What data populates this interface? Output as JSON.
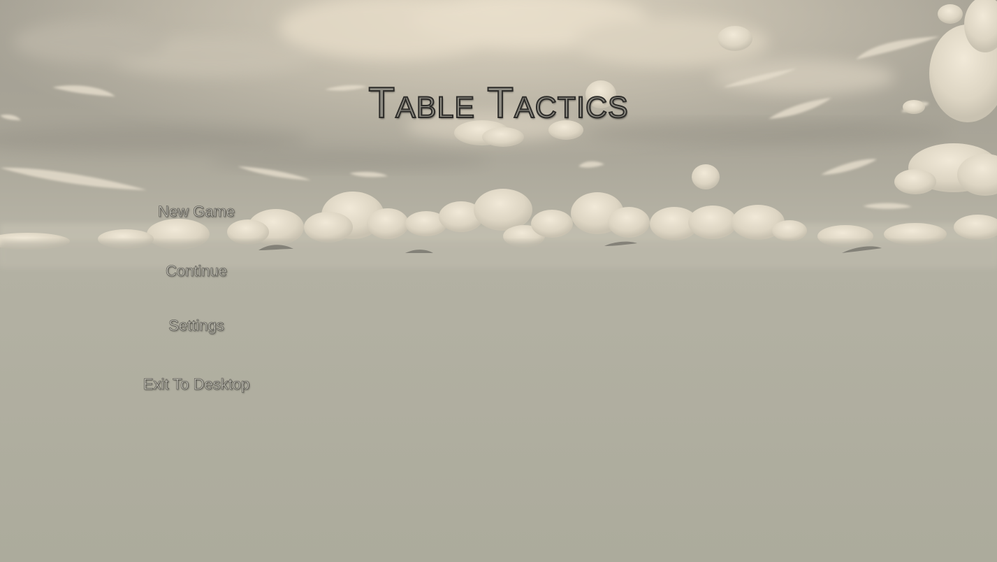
{
  "title": "Table Tactics",
  "menu": {
    "new_game": "New Game",
    "continue": "Continue",
    "settings": "Settings",
    "exit": "Exit To Desktop"
  },
  "colors": {
    "sky_top": "#9e9b90",
    "horizon": "#b9b7a9",
    "ground": "#afae9f",
    "cloud": "#ece4d2",
    "title_fill": "#8f8d84",
    "title_outline": "#2e2d2a",
    "button_text": "#c3c1b6"
  }
}
